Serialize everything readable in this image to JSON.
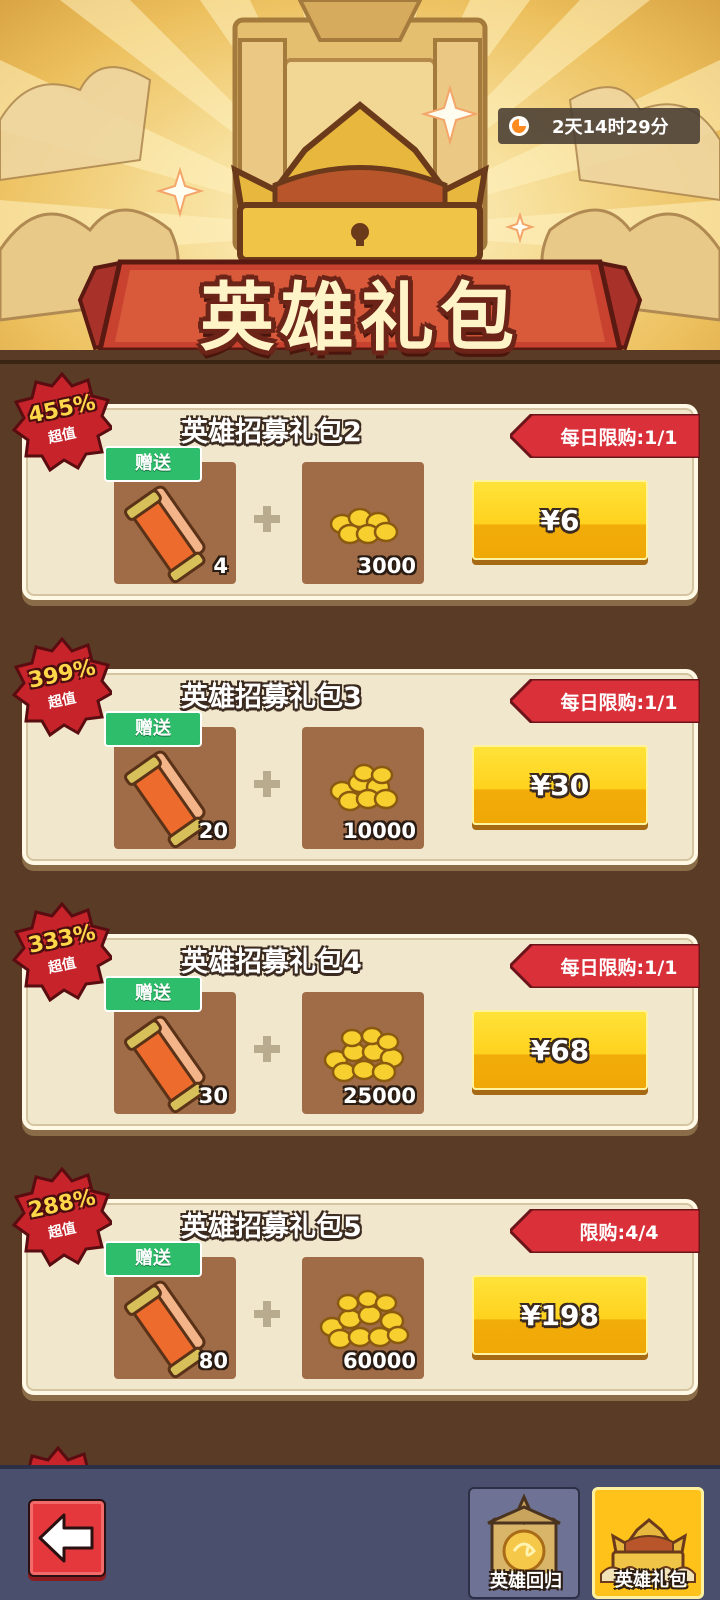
{
  "header": {
    "title": "英雄礼包",
    "timer": "2天14时29分",
    "timer_icon": "clock-icon"
  },
  "packs": [
    {
      "name": "英雄招募礼包2",
      "value_pct": "455%",
      "value_label": "超值",
      "limit": "每日限购:1/1",
      "gift_tag": "赠送",
      "scroll_qty": "4",
      "coin_qty": "3000",
      "price": "¥6"
    },
    {
      "name": "英雄招募礼包3",
      "value_pct": "399%",
      "value_label": "超值",
      "limit": "每日限购:1/1",
      "gift_tag": "赠送",
      "scroll_qty": "20",
      "coin_qty": "10000",
      "price": "¥30"
    },
    {
      "name": "英雄招募礼包4",
      "value_pct": "333%",
      "value_label": "超值",
      "limit": "每日限购:1/1",
      "gift_tag": "赠送",
      "scroll_qty": "30",
      "coin_qty": "25000",
      "price": "¥68"
    },
    {
      "name": "英雄招募礼包5",
      "value_pct": "288%",
      "value_label": "超值",
      "limit": "限购:4/4",
      "gift_tag": "赠送",
      "scroll_qty": "80",
      "coin_qty": "60000",
      "price": "¥198"
    }
  ],
  "bottom_bar": {
    "back_icon": "arrow-left-icon",
    "tabs": [
      {
        "label": "英雄回归",
        "icon": "portal-icon",
        "active": false
      },
      {
        "label": "英雄礼包",
        "icon": "crown-chest-icon",
        "active": true
      }
    ]
  },
  "colors": {
    "buy_button": "#ffd21e",
    "gift_tag": "#2ebd6b",
    "limit_tag": "#d9303a",
    "value_badge": "#c7232a",
    "active_tab": "#ffc21a"
  }
}
